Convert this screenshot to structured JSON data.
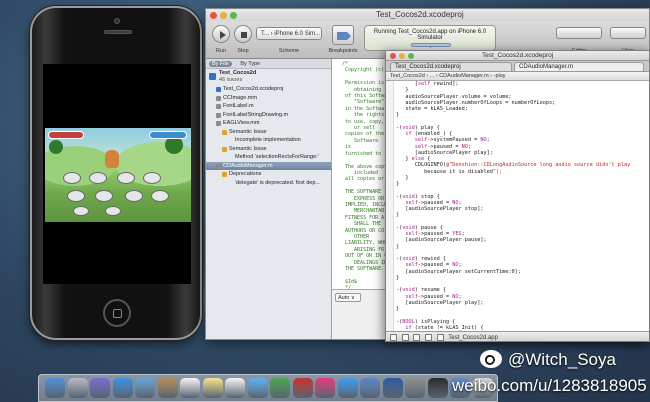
{
  "xcode": {
    "window_title": "Test_Cocos2d.xcodeproj",
    "toolbar": {
      "run_label": "Run",
      "stop_label": "Stop",
      "scheme_value": "T... › iPhone 6.0 Sim...",
      "scheme_label": "Scheme",
      "breakpoints_label": "Breakpoints",
      "status_line1": "Running Test_Cocos2d.app on iPhone 6.0 Simulator",
      "status_line2": "Project",
      "status_count": "46",
      "editor_label": "Editor",
      "view_label": "View"
    },
    "navigator": {
      "filter_chips": [
        "By File",
        "By Type"
      ],
      "project_name": "Test_Cocos2d",
      "issues_count": "46 issues",
      "items": [
        {
          "label": "Test_Cocos2d.xcodeproj",
          "indent": 1,
          "color": "#3b6ec2"
        },
        {
          "label": "CCImage.mm",
          "indent": 1,
          "color": "#8b8b8b"
        },
        {
          "label": "FontLabel.m",
          "indent": 1,
          "color": "#8b8b8b"
        },
        {
          "label": "FontLabelStringDrawing.m",
          "indent": 1,
          "color": "#8b8b8b"
        },
        {
          "label": "EAGLView.mm",
          "indent": 1,
          "color": "#8b8b8b"
        },
        {
          "label": "Semantic Issue",
          "indent": 2,
          "color": "#e3a126"
        },
        {
          "label": "Incomplete implementation",
          "indent": 3,
          "color": ""
        },
        {
          "label": "Semantic Issue",
          "indent": 2,
          "color": "#e3a126"
        },
        {
          "label": "Method 'selectionRectsForRange:'",
          "indent": 3,
          "color": ""
        },
        {
          "label": "CDAudioManager.m",
          "indent": 1,
          "color": "#8b8b8b",
          "selected": true
        },
        {
          "label": "Deprecations",
          "indent": 2,
          "color": "#e3a126"
        },
        {
          "label": "'delegate' is deprecated. first dep...",
          "indent": 3,
          "color": ""
        }
      ]
    },
    "left_editor_lines": [
      "/*",
      " Copyright (c)",
      "",
      " Permission is",
      "    obtaining",
      " of this Softwa",
      "    \"Software\"",
      " in the Softwar",
      "    the rights",
      " to use, copy,",
      "    or sell",
      " copies of the",
      "    Software",
      " is",
      " furnished to",
      "",
      " The above copy",
      "    included",
      " all copies or",
      "",
      " THE SOFTWARE I",
      "    EXPRESS OR",
      " IMPLIED, INCLU",
      "    MERCHANTAB",
      " FITNESS FOR A",
      "    SHALL THE",
      " AUTHORS OR CO",
      "    OTHER",
      " LIABILITY, WHE",
      "    ARISING FR",
      " OUT OF OR IN C",
      "    DEALINGS IN",
      " THE SOFTWARE.",
      "",
      " $Id$",
      " */"
    ],
    "bottom_selector": "Auto ∨"
  },
  "editor2": {
    "window_title": "Test_Cocos2d.xcodeproj",
    "tabs": [
      "Test_Cocos2d.xcodeproj",
      "CDAudioManager.m"
    ],
    "jump_bar": "Test_Cocos2d › ... › CDAudioManager.m › -play",
    "code_lines": [
      "      [self rewind];",
      "   }",
      "   audioSourcePlayer.volume = volume;",
      "   audioSourcePlayer.numberOfLoops = numberOfLoops;",
      "   state = kLAS_Loaded;",
      "}",
      "",
      "-(void) play {",
      "   if (enabled_) {",
      "      self->systemPaused = NO;",
      "      self->paused = NO;",
      "      [audioSourcePlayer play];",
      "   } else {",
      "      CDLOGINFO(@\"Denshion::CDLongAudioSource long audio source didn't play",
      "         because it is disabled\");",
      "   }",
      "}",
      "",
      "-(void) stop {",
      "   self->paused = NO;",
      "   [audioSourcePlayer stop];",
      "}",
      "",
      "-(void) pause {",
      "   self->paused = YES;",
      "   [audioSourcePlayer pause];",
      "}",
      "",
      "-(void) rewind {",
      "   self->paused = NO;",
      "   [audioSourcePlayer setCurrentTime:0];",
      "}",
      "",
      "-(void) resume {",
      "   self->paused = NO;",
      "   [audioSourcePlayer play];",
      "}",
      "",
      "-(BOOL) isPlaying {",
      "   if (state != kLAS_Init) {",
      "      return [audioSourcePlayer isPlaying];",
      "   } else {"
    ],
    "debug_bar": "Test_Cocos2d.app"
  },
  "watermark": {
    "handle": "@Witch_Soya",
    "url": "weibo.com/u/1283818905"
  },
  "dock": {
    "icons": [
      "finder",
      "launchpad",
      "mission-control",
      "safari",
      "mail",
      "contacts",
      "calendar",
      "notes",
      "reminders",
      "messages",
      "facetime",
      "photo-booth",
      "itunes",
      "app-store",
      "xcode",
      "instruments",
      "system-preferences",
      "terminal",
      "preview",
      "simulator"
    ],
    "colors": [
      "#4f8fd6",
      "#b8b8c8",
      "#7a6ad0",
      "#3f8fe0",
      "#6aa3d8",
      "#b58c55",
      "#f3f3f3",
      "#f4e28a",
      "#f2f2f2",
      "#5eb2f0",
      "#4aa54a",
      "#c83030",
      "#e33a7e",
      "#3b9cf2",
      "#5b86c5",
      "#2d5a9e",
      "#8e8e8e",
      "#2a2a2a",
      "#5e88c8",
      "#d8d8d8"
    ]
  }
}
